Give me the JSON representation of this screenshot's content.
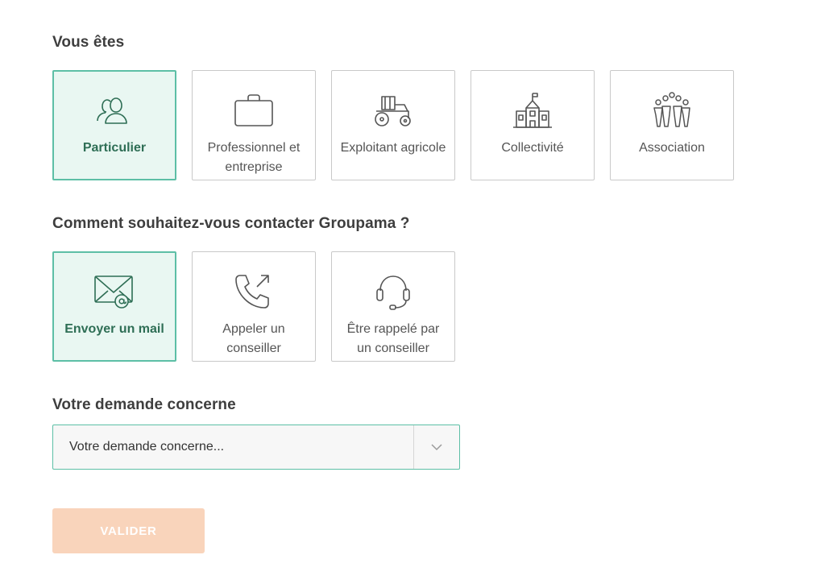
{
  "section_profile": {
    "title": "Vous êtes",
    "options": [
      {
        "label": "Particulier",
        "icon": "people-icon",
        "selected": true
      },
      {
        "label": "Professionnel et entreprise",
        "icon": "briefcase-icon",
        "selected": false
      },
      {
        "label": "Exploitant agricole",
        "icon": "tractor-icon",
        "selected": false
      },
      {
        "label": "Collectivité",
        "icon": "town-hall-icon",
        "selected": false
      },
      {
        "label": "Association",
        "icon": "group-icon",
        "selected": false
      }
    ]
  },
  "section_contact": {
    "title": "Comment souhaitez-vous contacter Groupama ?",
    "options": [
      {
        "label": "Envoyer un mail",
        "icon": "mail-icon",
        "selected": true
      },
      {
        "label": "Appeler un conseiller",
        "icon": "phone-icon",
        "selected": false
      },
      {
        "label": "Être rappelé par un conseiller",
        "icon": "headset-icon",
        "selected": false
      }
    ]
  },
  "section_request": {
    "title": "Votre demande concerne",
    "select_value": "Votre demande concerne..."
  },
  "submit_label": "VALIDER",
  "colors": {
    "accent": "#5dbfa6",
    "selected_bg": "#e9f7f2",
    "selected_text": "#2e6e55",
    "submit_bg": "#f9d4bb"
  }
}
